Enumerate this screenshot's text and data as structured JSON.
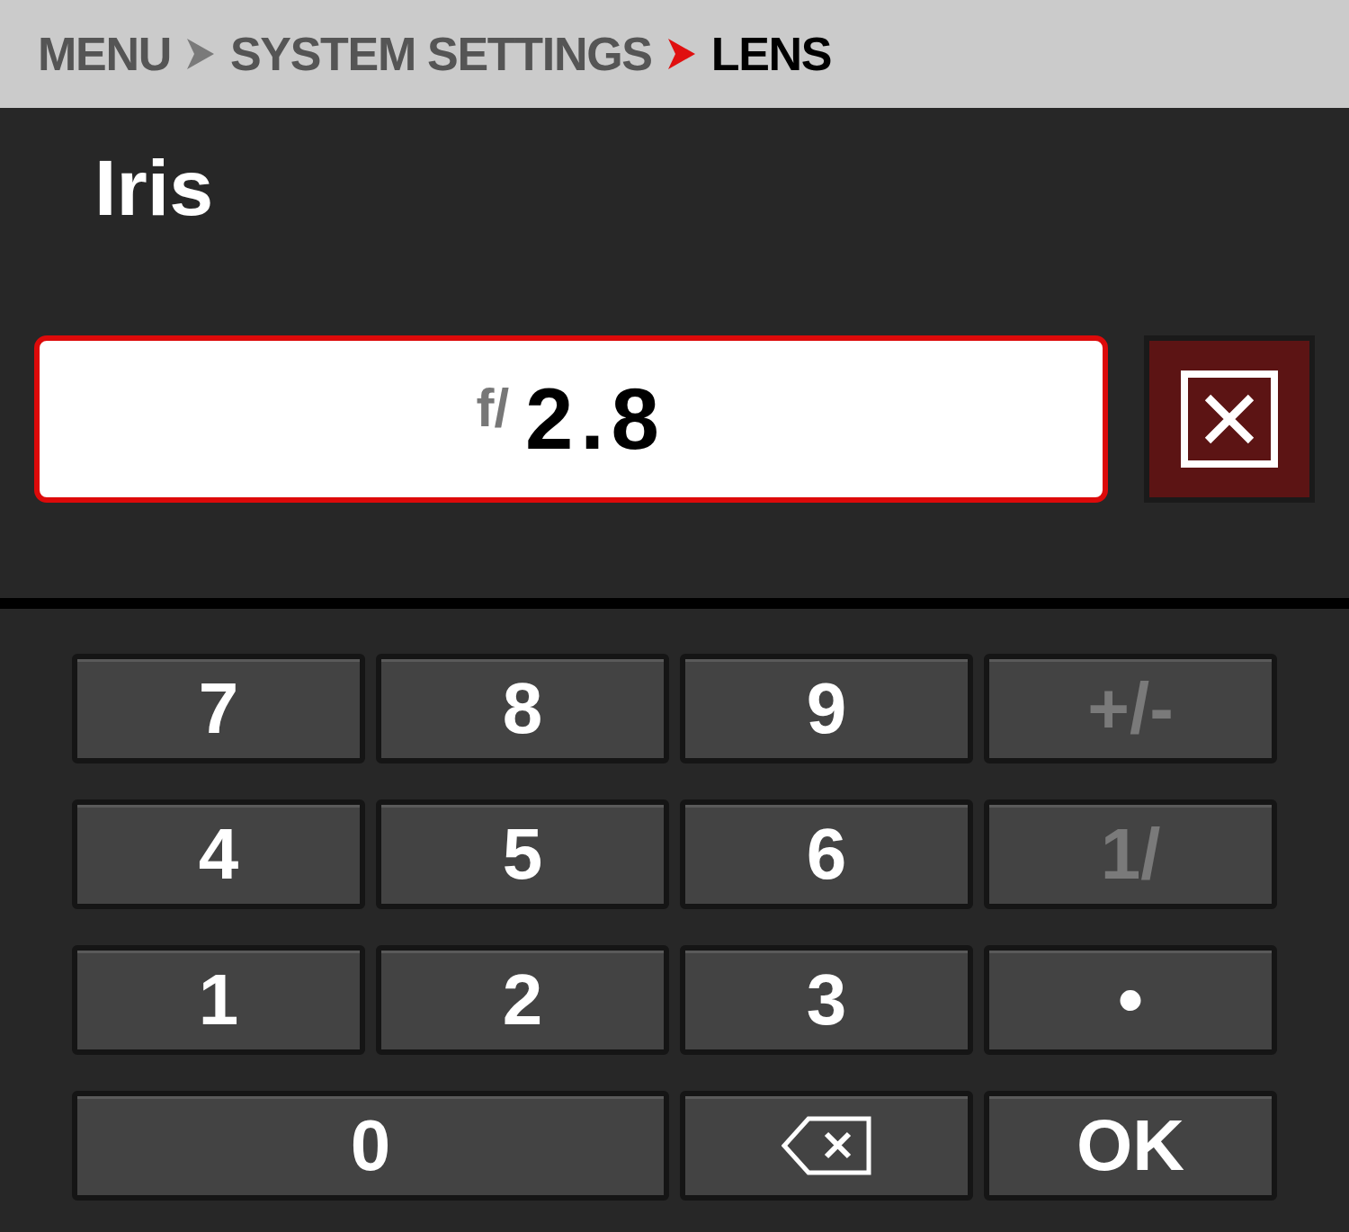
{
  "breadcrumb": [
    {
      "label": "MENU",
      "selected": false
    },
    {
      "label": "SYSTEM SETTINGS",
      "selected": false
    },
    {
      "label": "LENS",
      "selected": true
    }
  ],
  "title": "Iris",
  "value_field": {
    "prefix": "f/",
    "value": "2.8",
    "focused": true
  },
  "keys": [
    {
      "kind": "text",
      "label": "7",
      "disabled": false
    },
    {
      "kind": "text",
      "label": "8",
      "disabled": false
    },
    {
      "kind": "text",
      "label": "9",
      "disabled": false
    },
    {
      "kind": "text",
      "label": "+/-",
      "disabled": true
    },
    {
      "kind": "text",
      "label": "4",
      "disabled": false
    },
    {
      "kind": "text",
      "label": "5",
      "disabled": false
    },
    {
      "kind": "text",
      "label": "6",
      "disabled": false
    },
    {
      "kind": "text",
      "label": "1/",
      "disabled": true
    },
    {
      "kind": "text",
      "label": "1",
      "disabled": false
    },
    {
      "kind": "text",
      "label": "2",
      "disabled": false
    },
    {
      "kind": "text",
      "label": "3",
      "disabled": false
    },
    {
      "kind": "text",
      "label": "•",
      "disabled": false
    },
    {
      "kind": "wide",
      "label": "0",
      "disabled": false
    },
    {
      "kind": "backspace",
      "disabled": false
    },
    {
      "kind": "text",
      "label": "OK",
      "disabled": false
    }
  ]
}
